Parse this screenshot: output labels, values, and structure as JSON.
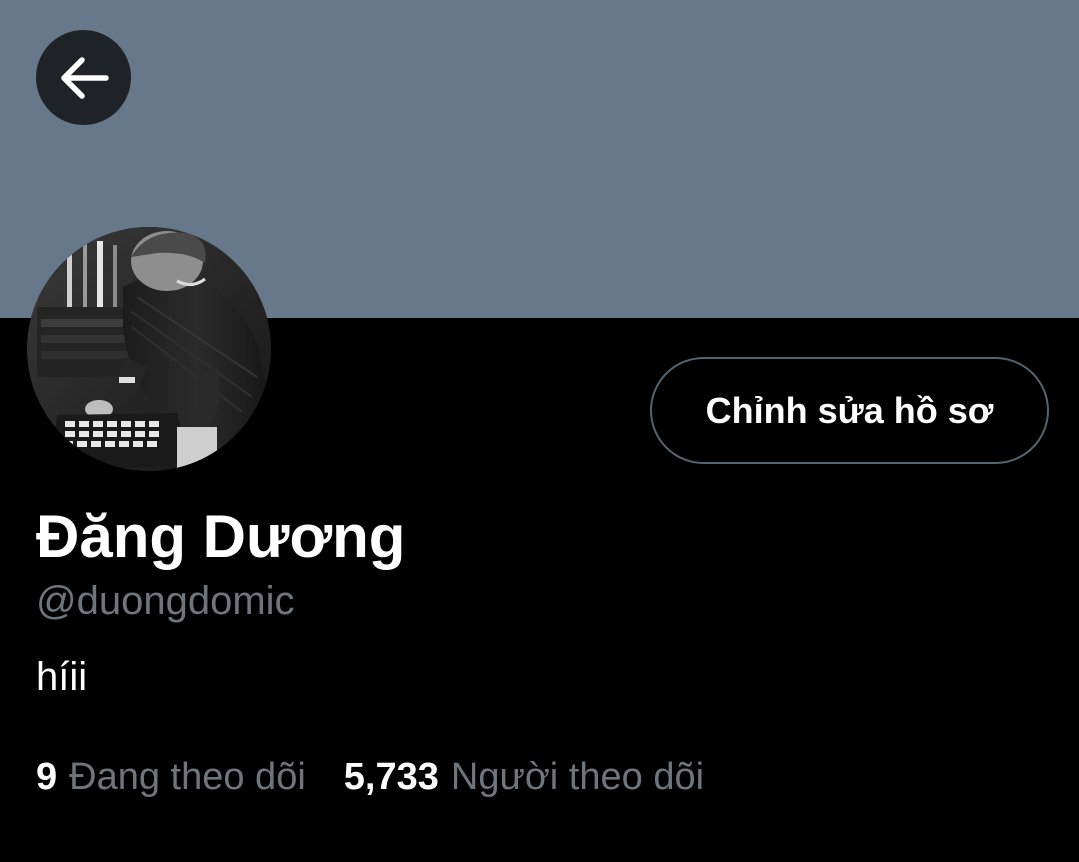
{
  "header": {
    "back_icon": "arrow-left-icon",
    "banner_color": "#66788a"
  },
  "profile": {
    "avatar_alt": "profile photo",
    "edit_button_label": "Chỉnh sửa hồ sơ",
    "display_name": "Đăng Dương",
    "handle": "@duongdomic",
    "bio": "híii"
  },
  "stats": {
    "following_count": "9",
    "following_label": "Đang theo dõi",
    "followers_count": "5,733",
    "followers_label": "Người theo dõi"
  },
  "colors": {
    "background": "#000000",
    "primary_text": "#ffffff",
    "secondary_text": "#6e767d",
    "button_border": "#536471"
  }
}
